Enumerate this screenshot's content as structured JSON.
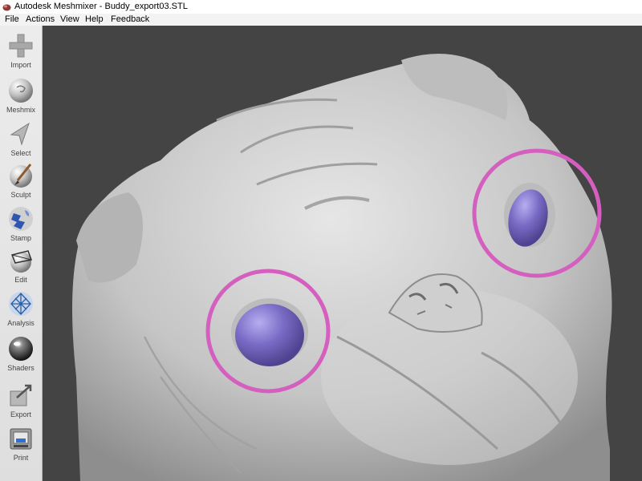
{
  "window": {
    "title": "Autodesk Meshmixer - Buddy_export03.STL"
  },
  "menu": {
    "file": "File",
    "actions": "Actions",
    "view": "View",
    "help": "Help",
    "feedback": "Feedback"
  },
  "sidebar": {
    "tools": [
      {
        "label": "Import",
        "icon": "plus-icon"
      },
      {
        "label": "Meshmix",
        "icon": "meshmix-sphere-icon"
      },
      {
        "label": "Select",
        "icon": "cursor-arrow-icon"
      },
      {
        "label": "Sculpt",
        "icon": "brush-sphere-icon"
      },
      {
        "label": "Stamp",
        "icon": "stamp-sphere-icon"
      },
      {
        "label": "Edit",
        "icon": "edit-sphere-icon"
      },
      {
        "label": "Analysis",
        "icon": "analysis-mesh-icon"
      },
      {
        "label": "Shaders",
        "icon": "shader-ball-icon"
      },
      {
        "label": "Export",
        "icon": "export-box-icon"
      },
      {
        "label": "Print",
        "icon": "printer-icon"
      }
    ]
  },
  "viewport": {
    "background_color": "#444444",
    "model_color": "#c8c8c8",
    "selection_color": "#7768c2",
    "highlight_ring_color": "#d45fbf"
  }
}
